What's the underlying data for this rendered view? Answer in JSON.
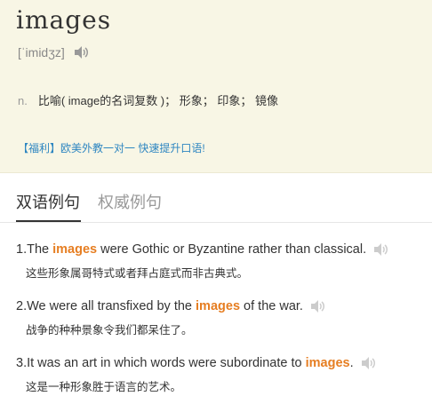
{
  "entry": {
    "word": "images",
    "phonetic": "[ˈimidʒz]",
    "definition": {
      "pos": "n.",
      "text": "比喻( image的名词复数 )； 形象； 印象； 镜像"
    },
    "promo": "【福利】欧美外教一对一 快速提升口语!"
  },
  "tabs": [
    {
      "label": "双语例句",
      "active": true
    },
    {
      "label": "权威例句",
      "active": false
    }
  ],
  "examples": [
    {
      "num": "1.",
      "before": "The ",
      "highlight": "images",
      "after": " were Gothic or Byzantine rather than classical.",
      "translation": "这些形象属哥特式或者拜占庭式而非古典式。"
    },
    {
      "num": "2.",
      "before": "We were all transfixed by the ",
      "highlight": "images",
      "after": " of the war.",
      "translation": "战争的种种景象令我们都呆住了。"
    },
    {
      "num": "3.",
      "before": "It was an art in which words were subordinate to ",
      "highlight": "images",
      "after": ".",
      "translation": "这是一种形象胜于语言的艺术。"
    }
  ],
  "colors": {
    "highlight": "#e67e22",
    "promo": "#2e86c1",
    "panel": "#f8f6e5"
  },
  "icons": {
    "speaker": "speaker-icon"
  }
}
